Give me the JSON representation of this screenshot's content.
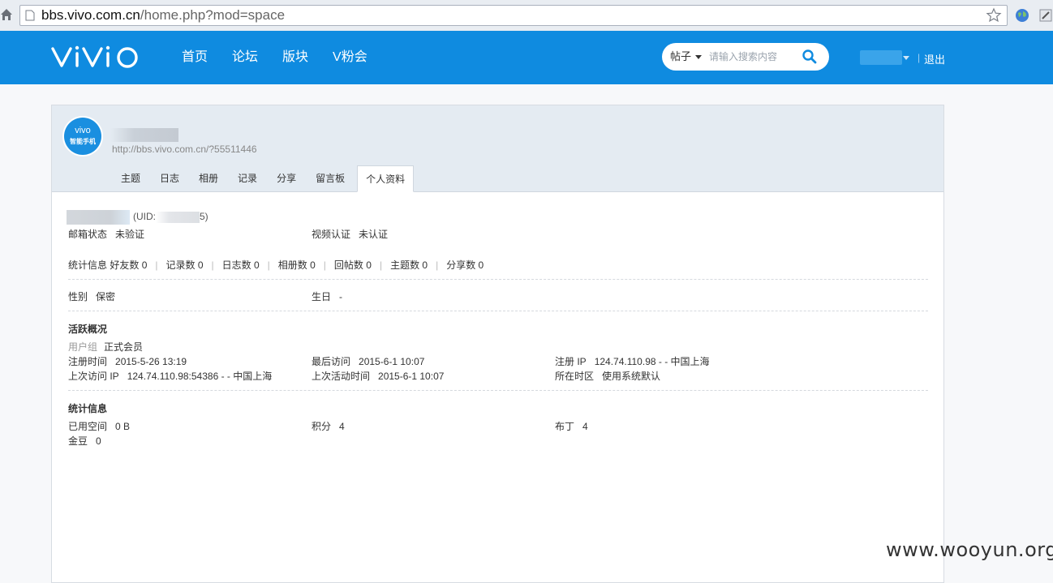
{
  "browser": {
    "url_host": "bbs.vivo.com.cn",
    "url_path": "/home.php?mod=space"
  },
  "header": {
    "brand": "vivo",
    "nav": [
      "首页",
      "论坛",
      "版块",
      "V粉会"
    ],
    "search_type": "帖子",
    "search_placeholder": "请输入搜索内容",
    "logout": "退出",
    "header_color": "#0f8be0"
  },
  "profile": {
    "avatar_text": "vivo",
    "avatar_subtext": "智能手机",
    "space_url": "http://bbs.vivo.com.cn/?55511446",
    "tabs": [
      "主题",
      "日志",
      "相册",
      "记录",
      "分享",
      "留言板",
      "个人资料"
    ],
    "active_tab": "个人资料",
    "uid_prefix": "(UID:",
    "uid_suffix": "5)"
  },
  "info": {
    "email_label": "邮箱状态",
    "email_value": "未验证",
    "video_label": "视频认证",
    "video_value": "未认证",
    "stats_label": "统计信息",
    "stats": [
      "好友数 0",
      "记录数 0",
      "日志数 0",
      "相册数 0",
      "回帖数 0",
      "主题数 0",
      "分享数 0"
    ],
    "gender_label": "性别",
    "gender_value": "保密",
    "birthday_label": "生日",
    "birthday_value": "-"
  },
  "activity": {
    "title": "活跃概况",
    "group_label": "用户组",
    "group_value": "正式会员",
    "reg_time_label": "注册时间",
    "reg_time_value": "2015-5-26 13:19",
    "last_visit_label": "最后访问",
    "last_visit_value": "2015-6-1 10:07",
    "reg_ip_label": "注册 IP",
    "reg_ip_value": "124.74.110.98 - - 中国上海",
    "prev_ip_label": "上次访问 IP",
    "prev_ip_value": "124.74.110.98:54386 - - 中国上海",
    "prev_active_label": "上次活动时间",
    "prev_active_value": "2015-6-1 10:07",
    "timezone_label": "所在时区",
    "timezone_value": "使用系统默认"
  },
  "statistics": {
    "title": "统计信息",
    "space_label": "已用空间",
    "space_value": "0 B",
    "points_label": "积分",
    "points_value": "4",
    "buding_label": "布丁",
    "buding_value": "4",
    "beans_label": "金豆",
    "beans_value": "0"
  },
  "watermark": "www.wooyun.org"
}
